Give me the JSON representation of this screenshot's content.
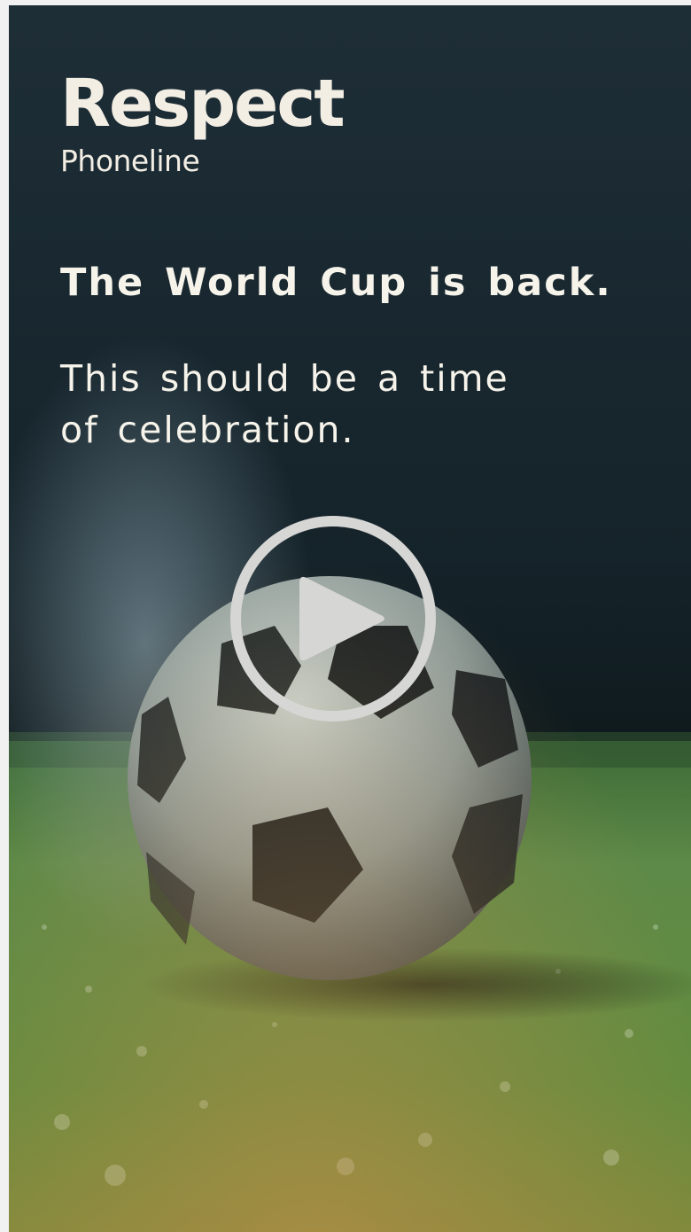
{
  "brand": {
    "title": "Respect",
    "subtitle": "Phoneline"
  },
  "message": {
    "headline": "The World Cup is back.",
    "line1": "This should be a time",
    "line2": "of celebration."
  },
  "video": {
    "play_icon": "play-icon"
  },
  "colors": {
    "text": "#f6f3ea",
    "background_top": "#1b2a33",
    "grass": "#5c8a3c"
  }
}
